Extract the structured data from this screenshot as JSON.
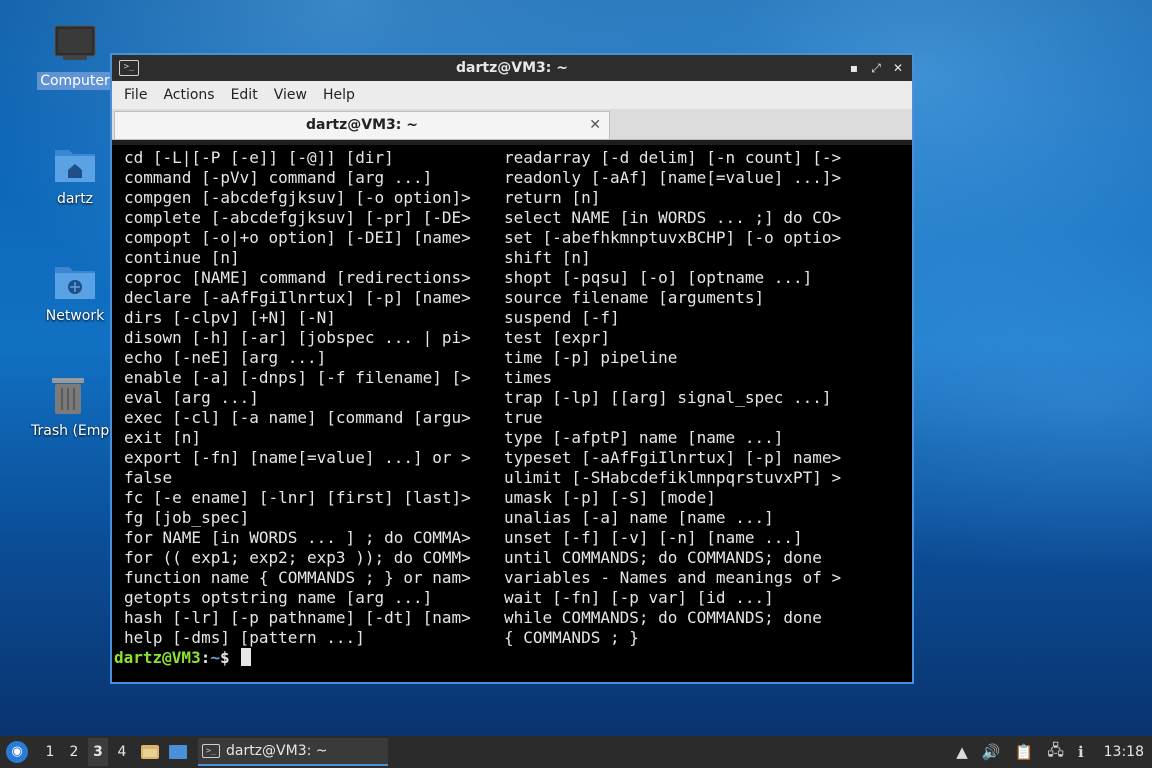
{
  "desktop": {
    "icons": [
      {
        "label": "Computer",
        "icon": "computer-icon"
      },
      {
        "label": "dartz",
        "icon": "home-folder-icon"
      },
      {
        "label": "Network",
        "icon": "network-folder-icon"
      },
      {
        "label": "Trash (Empt",
        "icon": "trash-icon"
      }
    ]
  },
  "window": {
    "title": "dartz@VM3: ~",
    "icon": "terminal-icon",
    "controls": {
      "minimize": "▪",
      "maximize": "⤢",
      "close": "✕"
    },
    "menu": [
      "File",
      "Actions",
      "Edit",
      "View",
      "Help"
    ],
    "tab": {
      "label": "dartz@VM3: ~",
      "close": "✕"
    }
  },
  "terminal": {
    "left": [
      "cd [-L|[-P [-e]] [-@]] [dir]",
      "command [-pVv] command [arg ...]",
      "compgen [-abcdefgjksuv] [-o option]>",
      "complete [-abcdefgjksuv] [-pr] [-DE>",
      "compopt [-o|+o option] [-DEI] [name>",
      "continue [n]",
      "coproc [NAME] command [redirections>",
      "declare [-aAfFgiIlnrtux] [-p] [name>",
      "dirs [-clpv] [+N] [-N]",
      "disown [-h] [-ar] [jobspec ... | pi>",
      "echo [-neE] [arg ...]",
      "enable [-a] [-dnps] [-f filename] [>",
      "eval [arg ...]",
      "exec [-cl] [-a name] [command [argu>",
      "exit [n]",
      "export [-fn] [name[=value] ...] or >",
      "false",
      "fc [-e ename] [-lnr] [first] [last]>",
      "fg [job_spec]",
      "for NAME [in WORDS ... ] ; do COMMA>",
      "for (( exp1; exp2; exp3 )); do COMM>",
      "function name { COMMANDS ; } or nam>",
      "getopts optstring name [arg ...]",
      "hash [-lr] [-p pathname] [-dt] [nam>",
      "help [-dms] [pattern ...]"
    ],
    "right": [
      "readarray [-d delim] [-n count] [->",
      "readonly [-aAf] [name[=value] ...]>",
      "return [n]",
      "select NAME [in WORDS ... ;] do CO>",
      "set [-abefhkmnptuvxBCHP] [-o optio>",
      "shift [n]",
      "shopt [-pqsu] [-o] [optname ...]",
      "source filename [arguments]",
      "suspend [-f]",
      "test [expr]",
      "time [-p] pipeline",
      "times",
      "trap [-lp] [[arg] signal_spec ...]",
      "true",
      "type [-afptP] name [name ...]",
      "typeset [-aAfFgiIlnrtux] [-p] name>",
      "ulimit [-SHabcdefiklmnpqrstuvxPT] >",
      "umask [-p] [-S] [mode]",
      "unalias [-a] name [name ...]",
      "unset [-f] [-v] [-n] [name ...]",
      "until COMMANDS; do COMMANDS; done",
      "variables - Names and meanings of >",
      "wait [-fn] [-p var] [id ...]",
      "while COMMANDS; do COMMANDS; done",
      "{ COMMANDS ; }"
    ],
    "prompt": {
      "user_host": "dartz@VM3",
      "sep": ":",
      "path": "~",
      "symbol": "$ "
    }
  },
  "taskbar": {
    "workspaces": [
      "1",
      "2",
      "3",
      "4"
    ],
    "active_workspace": "3",
    "task_label": "dartz@VM3: ~",
    "clock": "13:18",
    "colors": {
      "accent": "#4a90d9",
      "prompt_user": "#8ae234",
      "prompt_path": "#729fcf"
    }
  }
}
